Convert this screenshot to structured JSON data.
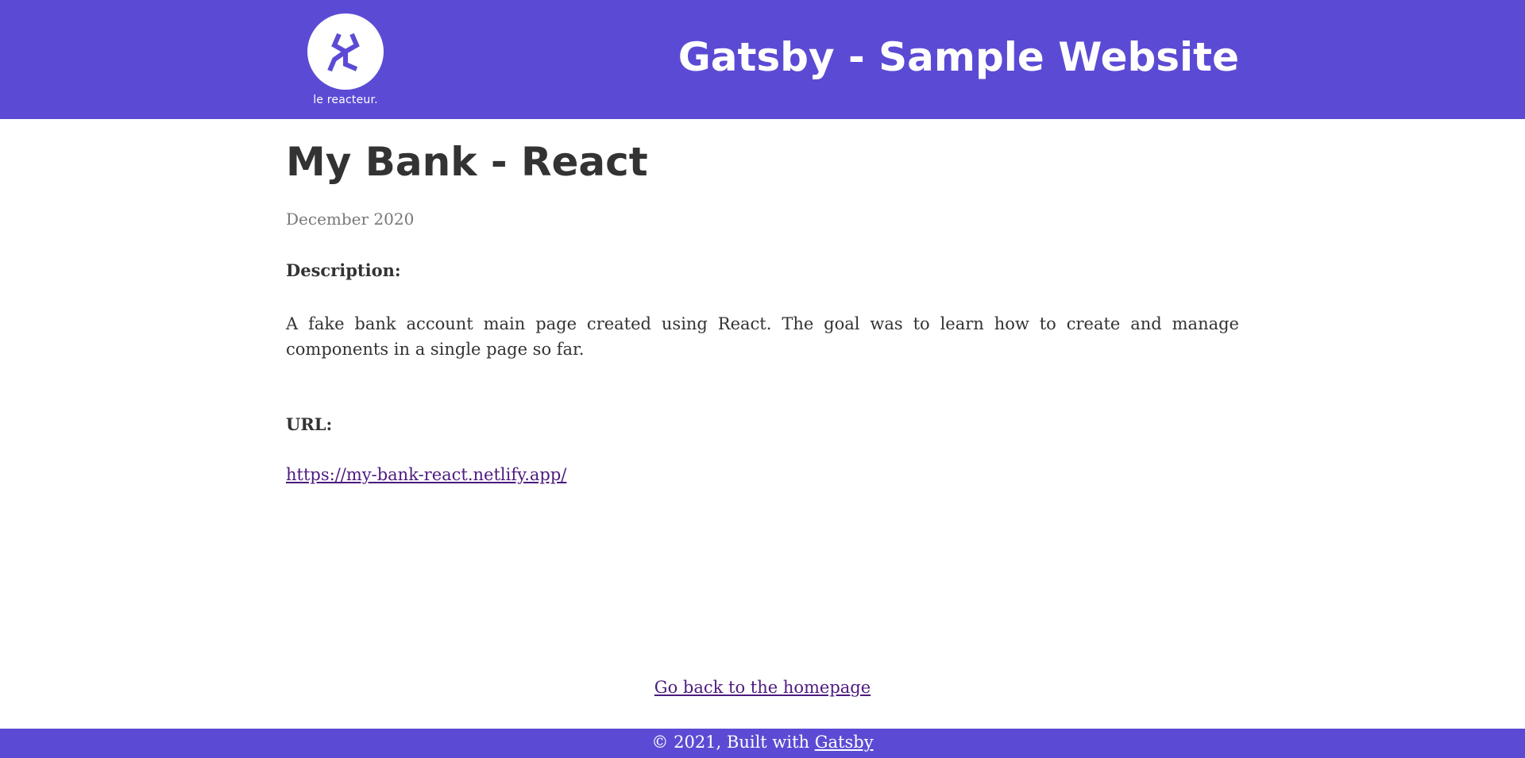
{
  "colors": {
    "brand": "#5b4bd4",
    "text": "#333333",
    "muted": "#777777",
    "link": "#4d1a7f"
  },
  "header": {
    "logo_text": "le reacteur.",
    "logo_icon": "reacteur-logo-icon",
    "site_title": "Gatsby - Sample Website"
  },
  "main": {
    "title": "My Bank - React",
    "date": "December 2020",
    "description_label": "Description:",
    "description": "A fake bank account main page created using React. The goal was to learn how to create and manage components in a single page so far.",
    "url_label": "URL:",
    "url": "https://my-bank-react.netlify.app/",
    "back_link": "Go back to the homepage"
  },
  "footer": {
    "prefix": "© 2021, Built with ",
    "link": "Gatsby"
  }
}
